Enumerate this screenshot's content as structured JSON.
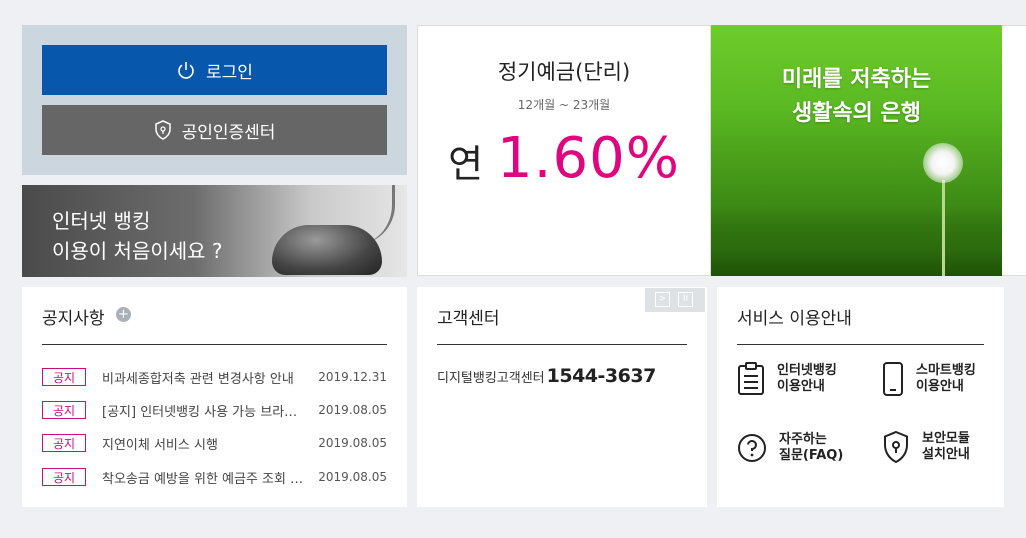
{
  "login": {
    "login_label": "로그인",
    "cert_label": "공인인증센터"
  },
  "ib_banner": {
    "line1": "인터넷 뱅킹",
    "line2": "이용이 처음이세요 ?"
  },
  "deposit": {
    "name": "정기예금(단리)",
    "period": "12개월 ~ 23개월",
    "rate_prefix": "연",
    "rate": "1.60%",
    "accent_color": "#e0057f"
  },
  "green_banner": {
    "line1": "미래를 저축하는",
    "line2": "생활속의 은행"
  },
  "notice": {
    "title": "공지사항",
    "more_icon": "plus-circle-icon",
    "items": [
      {
        "tag": "공지",
        "text": "비과세종합저축 관련 변경사항 안내",
        "date": "2019.12.31"
      },
      {
        "tag": "공지",
        "text": "[공지] 인터넷뱅킹 사용 가능 브라우저 안내",
        "date": "2019.08.05"
      },
      {
        "tag": "공지",
        "text": "지연이체 서비스 시행",
        "date": "2019.08.05"
      },
      {
        "tag": "공지",
        "text": "착오송금 예방을 위한 예금주 조회 서비스 안내",
        "date": "2019.08.05"
      }
    ]
  },
  "customer_center": {
    "title": "고객센터",
    "center_label": "디지털뱅킹고객센터",
    "phone": "1544-3637"
  },
  "slider_controls": {
    "next_icon": "chevron-right-icon",
    "pause_icon": "pause-icon"
  },
  "services": {
    "title": "서비스 이용안내",
    "items": [
      {
        "line1": "인터넷뱅킹",
        "line2": "이용안내",
        "icon": "clipboard-icon"
      },
      {
        "line1": "스마트뱅킹",
        "line2": "이용안내",
        "icon": "smartphone-icon"
      },
      {
        "line1": "자주하는",
        "line2": "질문(FAQ)",
        "icon": "question-circle-icon"
      },
      {
        "line1": "보안모듈",
        "line2": "설치안내",
        "icon": "shield-icon"
      }
    ]
  },
  "colors": {
    "primary": "#0757ad",
    "secondary_button": "#666666",
    "notice_tag": "#c8107c"
  }
}
